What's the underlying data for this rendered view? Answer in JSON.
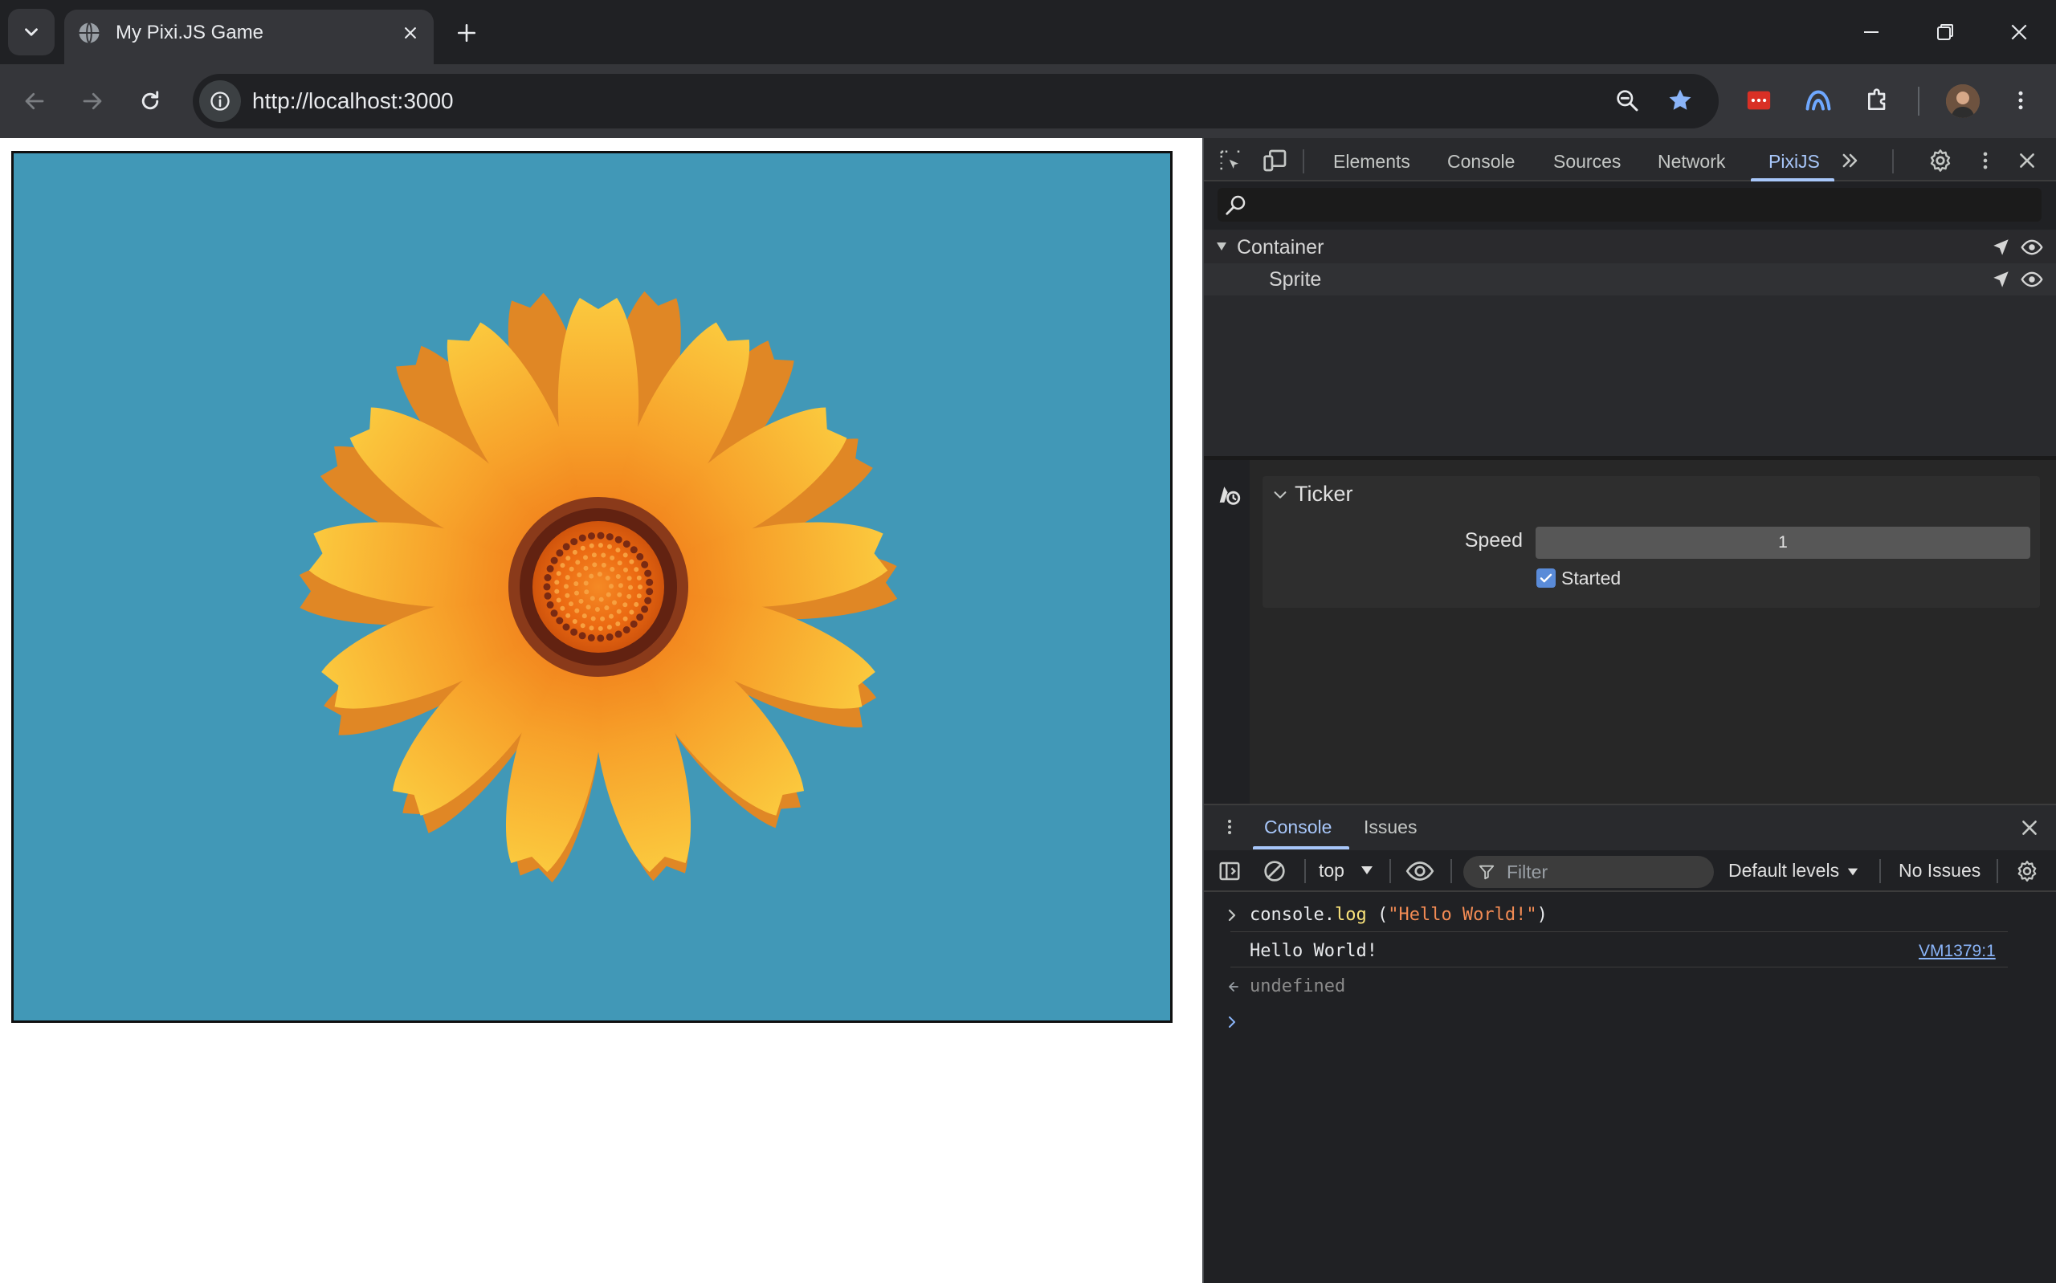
{
  "browser": {
    "tab_title": "My Pixi.JS Game",
    "url": "http://localhost:3000"
  },
  "colors": {
    "canvas_background": "#4198b7",
    "accent": "#a8c7fa",
    "devtools_background": "#202124"
  },
  "devtools": {
    "tabs": [
      {
        "label": "Elements"
      },
      {
        "label": "Console"
      },
      {
        "label": "Sources"
      },
      {
        "label": "Network"
      },
      {
        "label": "PixiJS",
        "active": true
      }
    ],
    "scene_tree": [
      {
        "label": "Container",
        "expanded": true
      },
      {
        "label": "Sprite"
      }
    ],
    "ticker": {
      "title": "Ticker",
      "speed_label": "Speed",
      "speed_value": "1",
      "started_label": "Started",
      "started_checked": true
    },
    "drawer": {
      "tabs": [
        {
          "label": "Console",
          "active": true
        },
        {
          "label": "Issues"
        }
      ],
      "context": "top",
      "filter_placeholder": "Filter",
      "levels": "Default levels",
      "issues": "No Issues"
    },
    "console": {
      "command": {
        "object": "console",
        "dot": ".",
        "method": "log",
        "open": " (",
        "argument": "\"Hello World!\"",
        "close": ")"
      },
      "output": "Hello World!",
      "source": "VM1379:1",
      "return_value": "undefined"
    }
  },
  "icons": [
    "down-chevron-icon",
    "globe-icon",
    "close-icon",
    "plus-icon",
    "minimize-icon",
    "restore-icon",
    "back-arrow-icon",
    "forward-arrow-icon",
    "reload-icon",
    "info-icon",
    "zoom-icon",
    "star-icon",
    "extension-icons",
    "puzzle-icon",
    "kebab-menu-icon",
    "inspect-icon",
    "device-toggle-icon",
    "more-tabs-icon",
    "gear-icon",
    "search-icon",
    "select-arrow-icon",
    "eye-icon",
    "ticker-icon",
    "sidebar-toggle-icon",
    "clear-icon",
    "filter-icon"
  ]
}
